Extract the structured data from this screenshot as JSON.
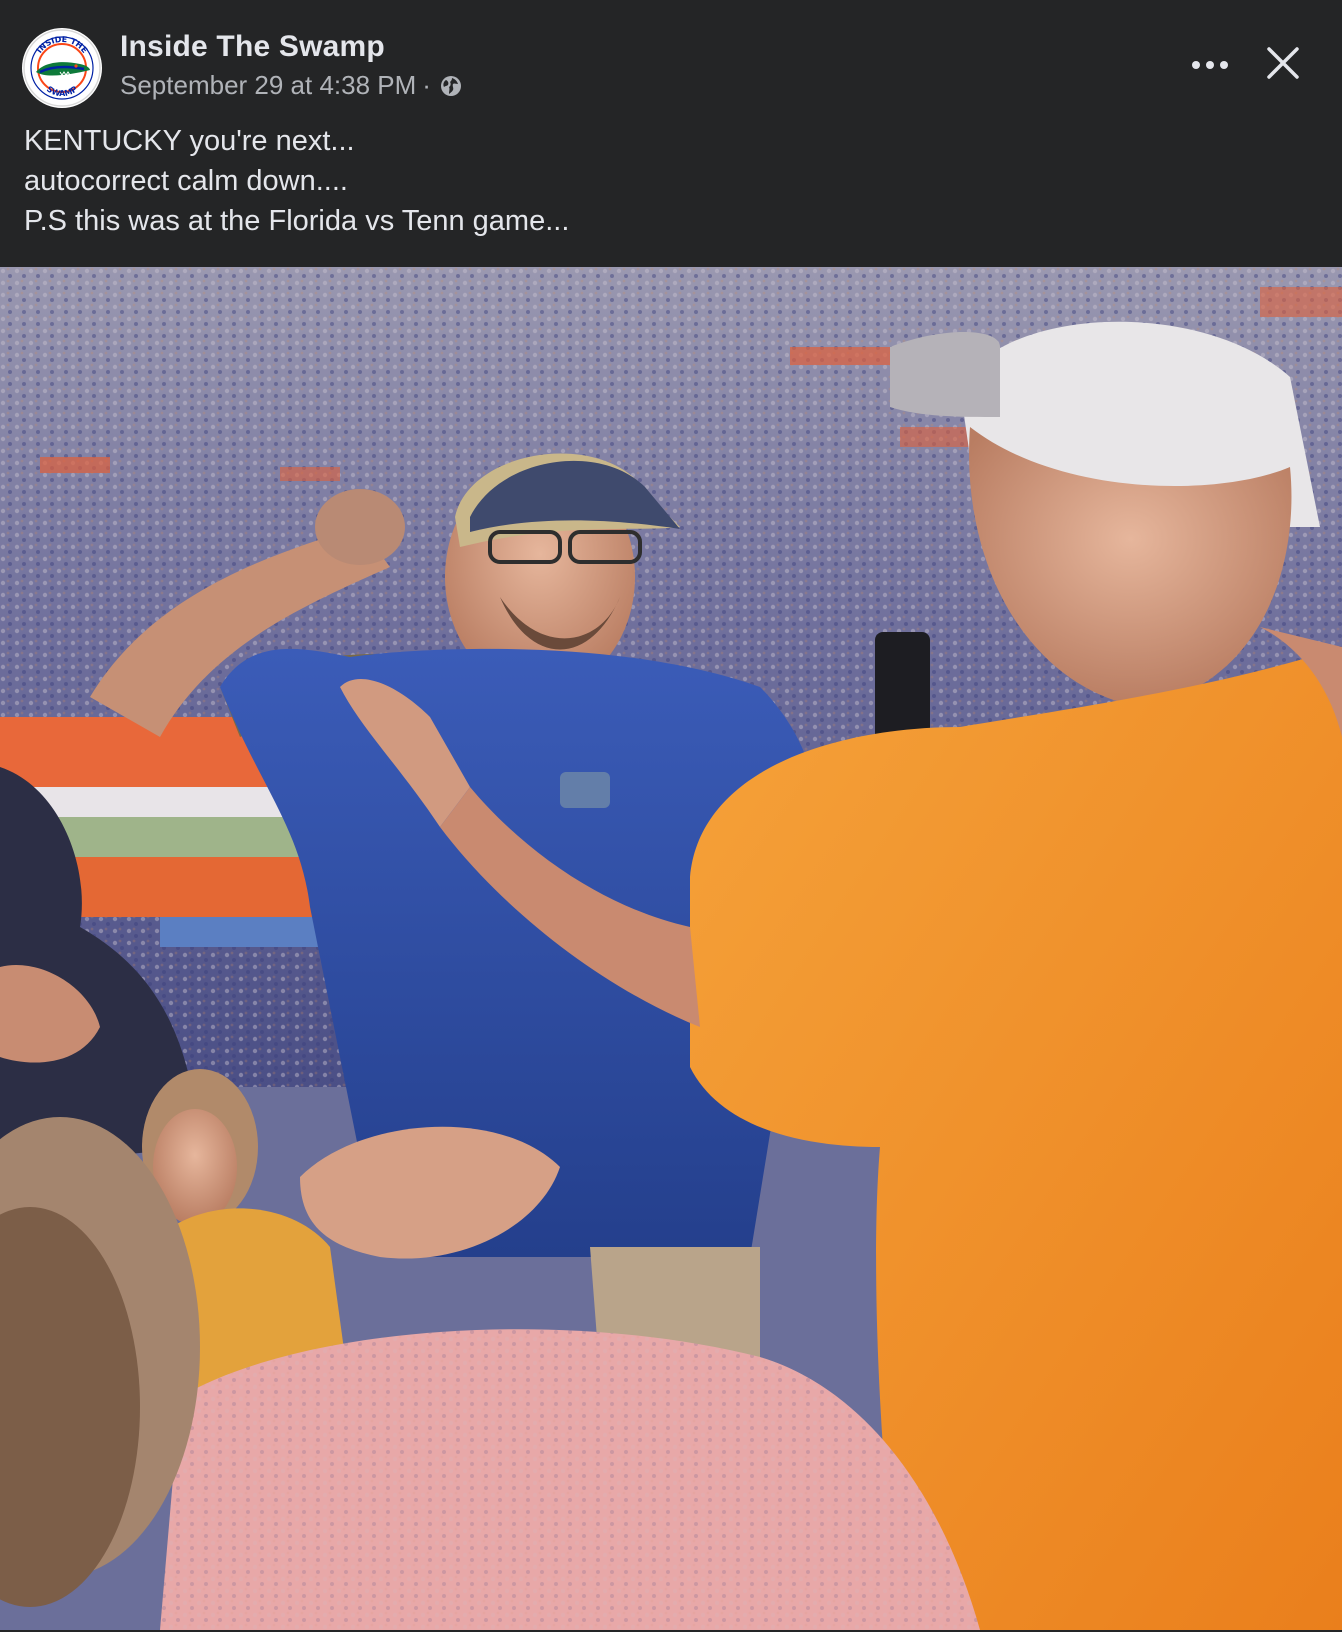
{
  "post": {
    "author": "Inside The Swamp",
    "timestamp": "September 29 at 4:38 PM",
    "separator": "·",
    "audience_icon": "globe-icon",
    "caption_lines": [
      "KENTUCKY you're next...",
      "autocorrect calm down....",
      "P.S this was at the Florida vs Tenn game..."
    ]
  },
  "controls": {
    "more_icon": "more-options-icon",
    "close_icon": "close-icon"
  },
  "avatar": {
    "logo_text_top": "INSIDE THE",
    "logo_text_bottom": "SWAMP"
  },
  "colors": {
    "background": "#242526",
    "primary_text": "#e4e6eb",
    "secondary_text": "#b0b3b8",
    "gator_blue": "#0021a5",
    "gator_orange": "#fa4616"
  }
}
